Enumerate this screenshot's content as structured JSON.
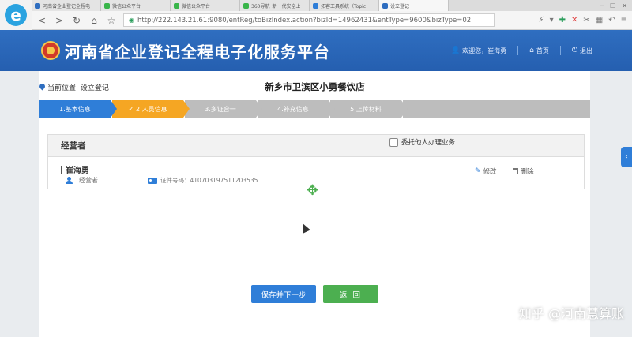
{
  "browser": {
    "tabs": [
      {
        "title": "河南省企业登记全程电",
        "color": "#2f6ec0"
      },
      {
        "title": "微信公众平台",
        "color": "#39b54a"
      },
      {
        "title": "微信公众平台",
        "color": "#39b54a"
      },
      {
        "title": "360导航_新一代安全上",
        "color": "#39b54a"
      },
      {
        "title": "拓客工具系统（Topic",
        "color": "#2f7ed8"
      },
      {
        "title": "设立登记",
        "color": "#2f6ec0"
      }
    ],
    "url": "http://222.143.21.61:9080/entReg/toBizIndex.action?bizId=14962431&entType=9600&bizType=02"
  },
  "header": {
    "title": "河南省企业登记全程电子化服务平台",
    "welcome": "欢迎您，崔海勇",
    "home": "首页",
    "logout": "退出"
  },
  "location": {
    "label": "当前位置: 设立登记"
  },
  "company_name": "新乡市卫滨区小勇餐饮店",
  "steps": [
    {
      "label": "1.基本信息",
      "state": "done"
    },
    {
      "label": "2.人员信息",
      "state": "current"
    },
    {
      "label": "3.多证合一",
      "state": "todo"
    },
    {
      "label": "4.补充信息",
      "state": "todo"
    },
    {
      "label": "5.上传材料",
      "state": "todo"
    }
  ],
  "panel": {
    "title": "经营者",
    "delegate_label": "委托他人办理业务",
    "person": {
      "name": "崔海勇",
      "role": "经营者",
      "id_label": "证件号码：410703197511203535",
      "edit": "修改",
      "delete": "删除"
    }
  },
  "buttons": {
    "save_next": "保存并下一步",
    "back": "返 回"
  },
  "watermark": "知乎 @河南慧算账",
  "colors": {
    "brand_blue": "#2f6ec0",
    "step_done": "#2f7ed8",
    "step_current": "#f5a623",
    "back_green": "#4caf50"
  }
}
